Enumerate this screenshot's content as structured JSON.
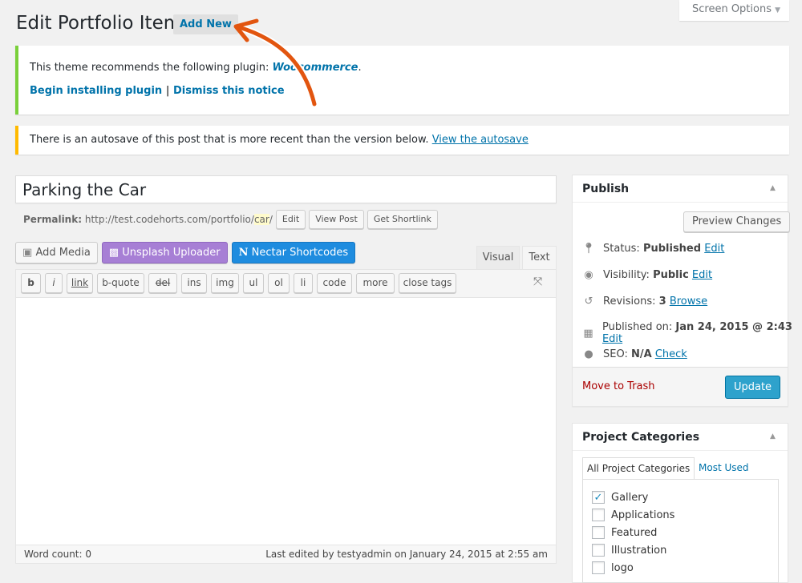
{
  "header": {
    "title": "Edit Portfolio Item",
    "add_new": "Add New",
    "screen_options": "Screen Options"
  },
  "notice_plugin": {
    "text": "This theme recommends the following plugin: ",
    "plugin": "Woocommerce",
    "period": ".",
    "begin": "Begin installing plugin",
    "sep": "|",
    "dismiss": "Dismiss this notice",
    "color": "#7ad03a"
  },
  "notice_autosave": {
    "text": "There is an autosave of this post that is more recent than the version below. ",
    "link": "View the autosave",
    "color": "#ffba00"
  },
  "post": {
    "title": "Parking the Car",
    "permalink_label": "Permalink:",
    "permalink_base": "http://test.codehorts.com/portfolio/",
    "permalink_slug": "car",
    "permalink_end": "/",
    "edit": "Edit",
    "view_post": "View Post",
    "get_shortlink": "Get Shortlink"
  },
  "media": {
    "add_media": "Add Media",
    "unsplash": "Unsplash Uploader",
    "nectar": "Nectar Shortcodes",
    "unsplash_color": "#a77fd5",
    "nectar_color": "#1e8cdf"
  },
  "editor_tabs": {
    "visual": "Visual",
    "text": "Text"
  },
  "quicktags": [
    "b",
    "i",
    "link",
    "b-quote",
    "del",
    "ins",
    "img",
    "ul",
    "ol",
    "li",
    "code",
    "more",
    "close tags"
  ],
  "status_bar": {
    "word_count": "Word count: 0",
    "last_edited": "Last edited by testyadmin on January 24, 2015 at 2:55 am"
  },
  "publish": {
    "title": "Publish",
    "preview": "Preview Changes",
    "status_label": "Status: ",
    "status": "Published",
    "visibility_label": "Visibility: ",
    "visibility": "Public",
    "revisions_label": "Revisions: ",
    "revisions": "3",
    "browse": "Browse",
    "published_label": "Published on: ",
    "published": "Jan 24, 2015 @ 2:43",
    "seo_label": "SEO: ",
    "seo": "N/A",
    "check": "Check",
    "edit": "Edit",
    "trash": "Move to Trash",
    "update": "Update"
  },
  "categories": {
    "title": "Project Categories",
    "tab_all": "All Project Categories",
    "tab_used": "Most Used",
    "items": [
      {
        "label": "Gallery",
        "checked": true
      },
      {
        "label": "Applications",
        "checked": false
      },
      {
        "label": "Featured",
        "checked": false
      },
      {
        "label": "Illustration",
        "checked": false
      },
      {
        "label": "logo",
        "checked": false
      }
    ]
  }
}
